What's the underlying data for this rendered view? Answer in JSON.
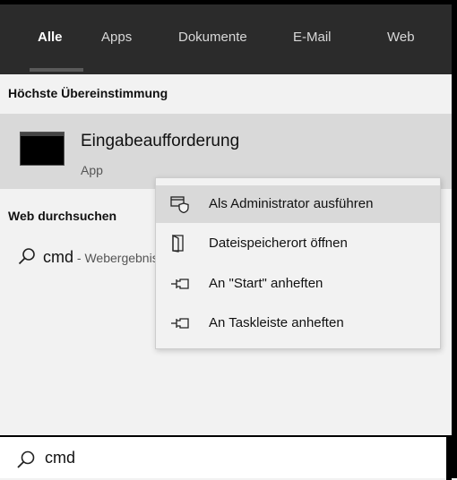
{
  "tabs": [
    {
      "label": "Alle",
      "active": true
    },
    {
      "label": "Apps"
    },
    {
      "label": "Dokumente"
    },
    {
      "label": "E-Mail"
    },
    {
      "label": "Web"
    }
  ],
  "best_match": {
    "heading": "Höchste Übereinstimmung",
    "title": "Eingabeaufforderung",
    "subtitle": "App"
  },
  "web_section": {
    "heading": "Web durchsuchen",
    "query": "cmd",
    "suffix": " - Webergebnisse anzeigen"
  },
  "context_menu": {
    "items": [
      {
        "label": "Als Administrator ausführen",
        "icon": "shield-run-icon"
      },
      {
        "label": "Dateispeicherort öffnen",
        "icon": "folder-open-icon"
      },
      {
        "label": "An \"Start\" anheften",
        "icon": "pin-icon"
      },
      {
        "label": "An Taskleiste anheften",
        "icon": "pin-icon"
      }
    ]
  },
  "search": {
    "value": "cmd"
  },
  "colors": {
    "tab_bar": "#2b2b2b",
    "highlight": "#d9d9d9",
    "panel": "#f2f2f2"
  }
}
